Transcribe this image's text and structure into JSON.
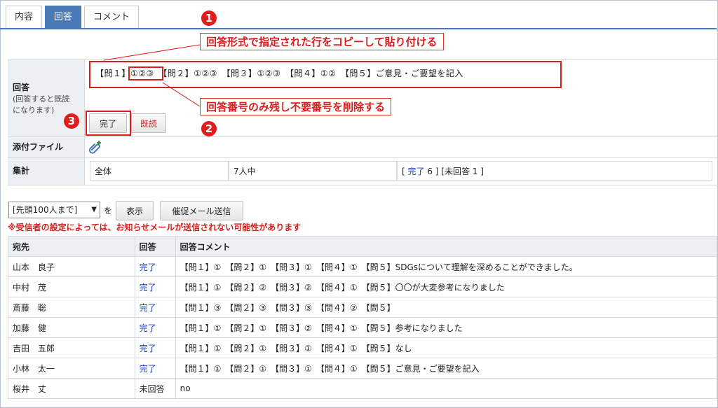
{
  "tabs": [
    {
      "label": "内容",
      "active": false
    },
    {
      "label": "回答",
      "active": true
    },
    {
      "label": "コメント",
      "active": false
    }
  ],
  "form": {
    "answer_label": "回答",
    "answer_sub1": "(回答すると既読",
    "answer_sub2": "になります)",
    "answer_value": "【問１】①②③　【問２】①②③　【問３】①②③　【問４】①②　【問５】ご意見・ご要望を記入",
    "complete_button": "完了",
    "read_button": "既読",
    "attach_label": "添付ファイル",
    "summary_label": "集計",
    "summary_all": "全体",
    "summary_count": "7人中",
    "summary_status_open": "[ ",
    "summary_status_link": "完了",
    "summary_status_rest": " 6 ] [未回答 1 ]"
  },
  "annotations": {
    "callout1": "回答形式で指定された行をコピーして貼り付ける",
    "callout2": "回答番号のみ残し不要番号を削除する",
    "badge1": "1",
    "badge2": "2",
    "badge3": "3"
  },
  "controls": {
    "select_value": "[先頭100人まで]",
    "wo": "を",
    "show_button": "表示",
    "remind_button": "催促メール送信",
    "warning": "※受信者の設定によっては、お知らせメールが送信されない可能性があります"
  },
  "list": {
    "headers": [
      "宛先",
      "回答",
      "回答コメント"
    ],
    "rows": [
      {
        "name": "山本　良子",
        "status": "完了",
        "comment": "【問１】①　【問２】①　【問３】①　【問４】①　【問５】SDGsについて理解を深めることができました。"
      },
      {
        "name": "中村　茂",
        "status": "完了",
        "comment": "【問１】①　【問２】②　【問３】②　【問４】①　【問５】〇〇が大変参考になりました"
      },
      {
        "name": "斎藤　聡",
        "status": "完了",
        "comment": "【問１】③　【問２】③　【問３】③　【問４】②　【問５】"
      },
      {
        "name": "加藤　健",
        "status": "完了",
        "comment": "【問１】①　【問２】①　【問３】②　【問４】①　【問５】参考になりました"
      },
      {
        "name": "吉田　五郎",
        "status": "完了",
        "comment": "【問１】①　【問２】①　【問３】①　【問４】①　【問５】なし"
      },
      {
        "name": "小林　太一",
        "status": "完了",
        "comment": "【問１】①　【問２】①　【問３】①　【問４】①　【問５】ご意見・ご要望を記入"
      },
      {
        "name": "桜井　丈",
        "status": "未回答",
        "comment": "no"
      }
    ]
  },
  "colors": {
    "accent": "#4a79b8",
    "annotation": "#d81e1e",
    "link": "#1a3fb0"
  }
}
